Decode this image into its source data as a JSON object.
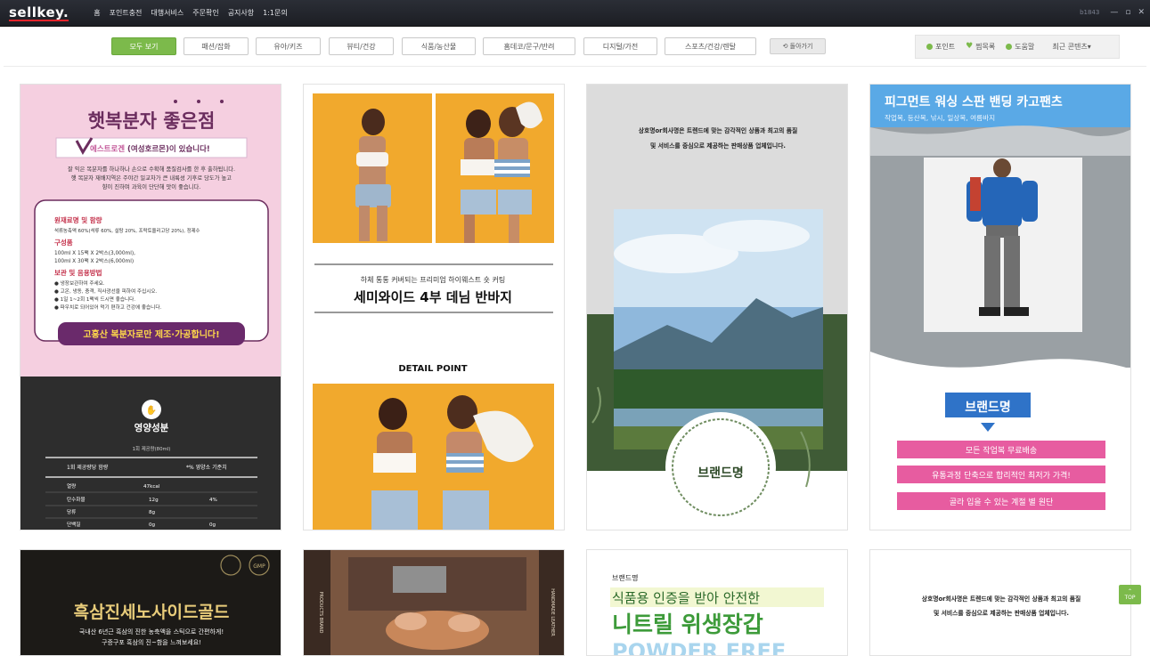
{
  "app": {
    "logo": "sellkey."
  },
  "topmenu": [
    "홈",
    "포인트충전",
    "대행서비스",
    "주문확인",
    "공지사항",
    "1:1문의"
  ],
  "window": {
    "user_id": "b1843",
    "minimize": "—",
    "restore": "▫",
    "close": "✕"
  },
  "categories": {
    "items": [
      "모두 보기",
      "패션/잡화",
      "유아/키즈",
      "뷰티/건강",
      "식품/농산물",
      "홈데코/문구/반려",
      "디지털/가전",
      "스포츠/건강/렌탈"
    ],
    "active": "모두 보기",
    "accent": "#7cba4b"
  },
  "back_label": "⟲ 돌아가기",
  "utility": {
    "point": "포인트",
    "wishlist": "찜목록",
    "help": "도움말",
    "recent": "최근 콘텐츠▾"
  },
  "cards": {
    "c1": {
      "title": "햇복분자 좋은점",
      "slogan_prefix": "에스트로겐",
      "slogan_suffix": "(여성호르몬)이 있습니다!",
      "desc1": "잘 익은 복분자를 하나하나 손으로 수확해 품질검사를 한 후 출하됩니다.",
      "desc2": "햇 복분자 재배지역은 주야간 일교차가 큰 내륙성 기후로 당도가 높고",
      "desc3": "향이 진하며 과육이 단단해 맛이 좋습니다.",
      "h1": "원재료명 및 함량",
      "t1": "석류농축액 60%(석류 60%, 설탕 20%, 프락토올리고당 20%), 정제수",
      "h2": "구성품",
      "t2a": "100ml X 15팩 X 2박스(3,000ml),",
      "t2b": "100ml X 30팩 X 2박스(6,000ml)",
      "h3": "보관 및 음용방법",
      "t3a": "● 냉장보관하여 주세요.",
      "t3b": "● 고온, 냉동, 충격, 직사광선을 피하여 주십시오.",
      "t3c": "● 1일 1~2회 1팩씩 드시면 좋습니다.",
      "t3d": "● 파우치로 되어있어 먹기 편하고 건강에 좋습니다.",
      "cta": "고흥산 복분자로만 제조·가공합니다!",
      "nutri_title": "영양성분",
      "nutri_sub": "1회 제공량(80ml)",
      "nutri_head1": "1회 제공량당 함량",
      "nutri_head2": "*% 영양소 기준치",
      "rows": [
        {
          "name": "열량",
          "amount": "47kcal",
          "pct": ""
        },
        {
          "name": "탄수화물",
          "amount": "12g",
          "pct": "4%"
        },
        {
          "name": "당류",
          "amount": "8g",
          "pct": ""
        },
        {
          "name": "단백질",
          "amount": "0g",
          "pct": "0g"
        }
      ]
    },
    "c2": {
      "sub": "하체 통통 커버되는 프리미엄 하이웨스트 숏 커팅",
      "title": "세미와이드 4부 데님 반바지",
      "detail": "DETAIL POINT"
    },
    "c3": {
      "line1": "상호명or회사명은 트렌드에 맞는 감각적인 상품과 최고의 품질",
      "line2": "및 서비스를 중심으로 제공하는 판매상품 업체입니다.",
      "brand": "브랜드명"
    },
    "c4": {
      "title": "피그먼트 워싱 스판 밴딩 카고팬츠",
      "sub": "작업복, 등산복, 낚시, 일상복, 여름바지",
      "brand": "브랜드명",
      "b1": "모든 작업복 무료배송",
      "b2": "유통과정 단축으로 합리적인 최저가 가격!",
      "b3": "골라 입을 수 있는 계절 별 원단"
    },
    "c5": {
      "title": "흑삼진세노사이드골드",
      "line1": "국내산 6년근 흑삼의 진한 농축액을 스틱으로 간편하게!",
      "line2": "구증구포 흑삼의 진~함을 느껴보세요!",
      "badge": "GMP"
    },
    "c6": {
      "left": "PRODUCTS BRAND",
      "right": "HANDMADE LEATHER"
    },
    "c7": {
      "brand": "브랜드명",
      "line1": "식품용 인증을 받아 안전한",
      "line2": "니트릴 위생장갑",
      "line3": "POWDER FREE"
    },
    "c8": {
      "line1": "상호명or회사명은 트렌드에 맞는 감각적인 상품과 최고의 품질",
      "line2": "및 서비스를 중심으로 제공하는 판매상품 업체입니다."
    }
  },
  "top_button": "TOP"
}
